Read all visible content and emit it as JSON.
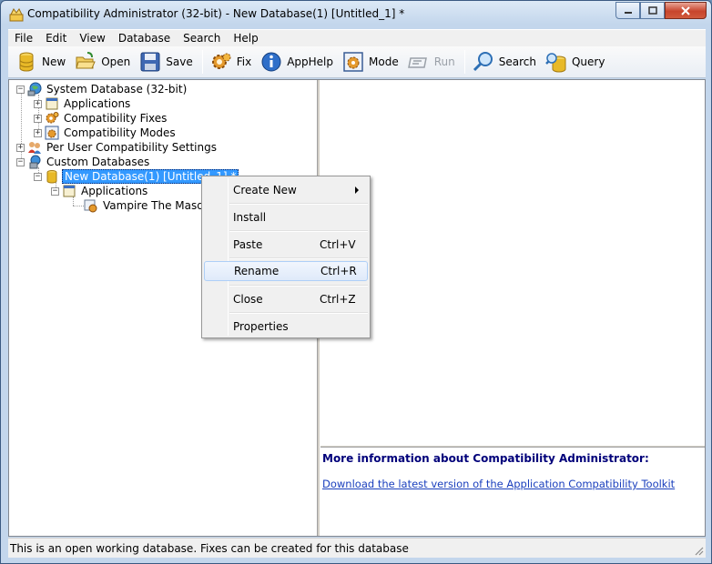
{
  "window": {
    "title": "Compatibility Administrator (32-bit) - New Database(1) [Untitled_1] *"
  },
  "menubar": [
    "File",
    "Edit",
    "View",
    "Database",
    "Search",
    "Help"
  ],
  "toolbar": {
    "new": "New",
    "open": "Open",
    "save": "Save",
    "fix": "Fix",
    "apphelp": "AppHelp",
    "mode": "Mode",
    "run": "Run",
    "search": "Search",
    "query": "Query"
  },
  "tree": {
    "system_db": "System Database (32-bit)",
    "applications": "Applications",
    "compat_fixes": "Compatibility Fixes",
    "compat_modes": "Compatibility Modes",
    "per_user": "Per User Compatibility Settings",
    "custom_dbs": "Custom Databases",
    "new_db": "New Database(1) [Untitled_1] *",
    "new_db_apps": "Applications",
    "app_entry": "Vampire The Masquerade"
  },
  "info": {
    "heading": "More information about Compatibility Administrator:",
    "link": "Download the latest version of the Application Compatibility Toolkit"
  },
  "context_menu": {
    "create_new": "Create New",
    "install": "Install",
    "paste": "Paste",
    "paste_sc": "Ctrl+V",
    "rename": "Rename",
    "rename_sc": "Ctrl+R",
    "close": "Close",
    "close_sc": "Ctrl+Z",
    "properties": "Properties"
  },
  "status": "This is an open working database. Fixes can be created for this database"
}
